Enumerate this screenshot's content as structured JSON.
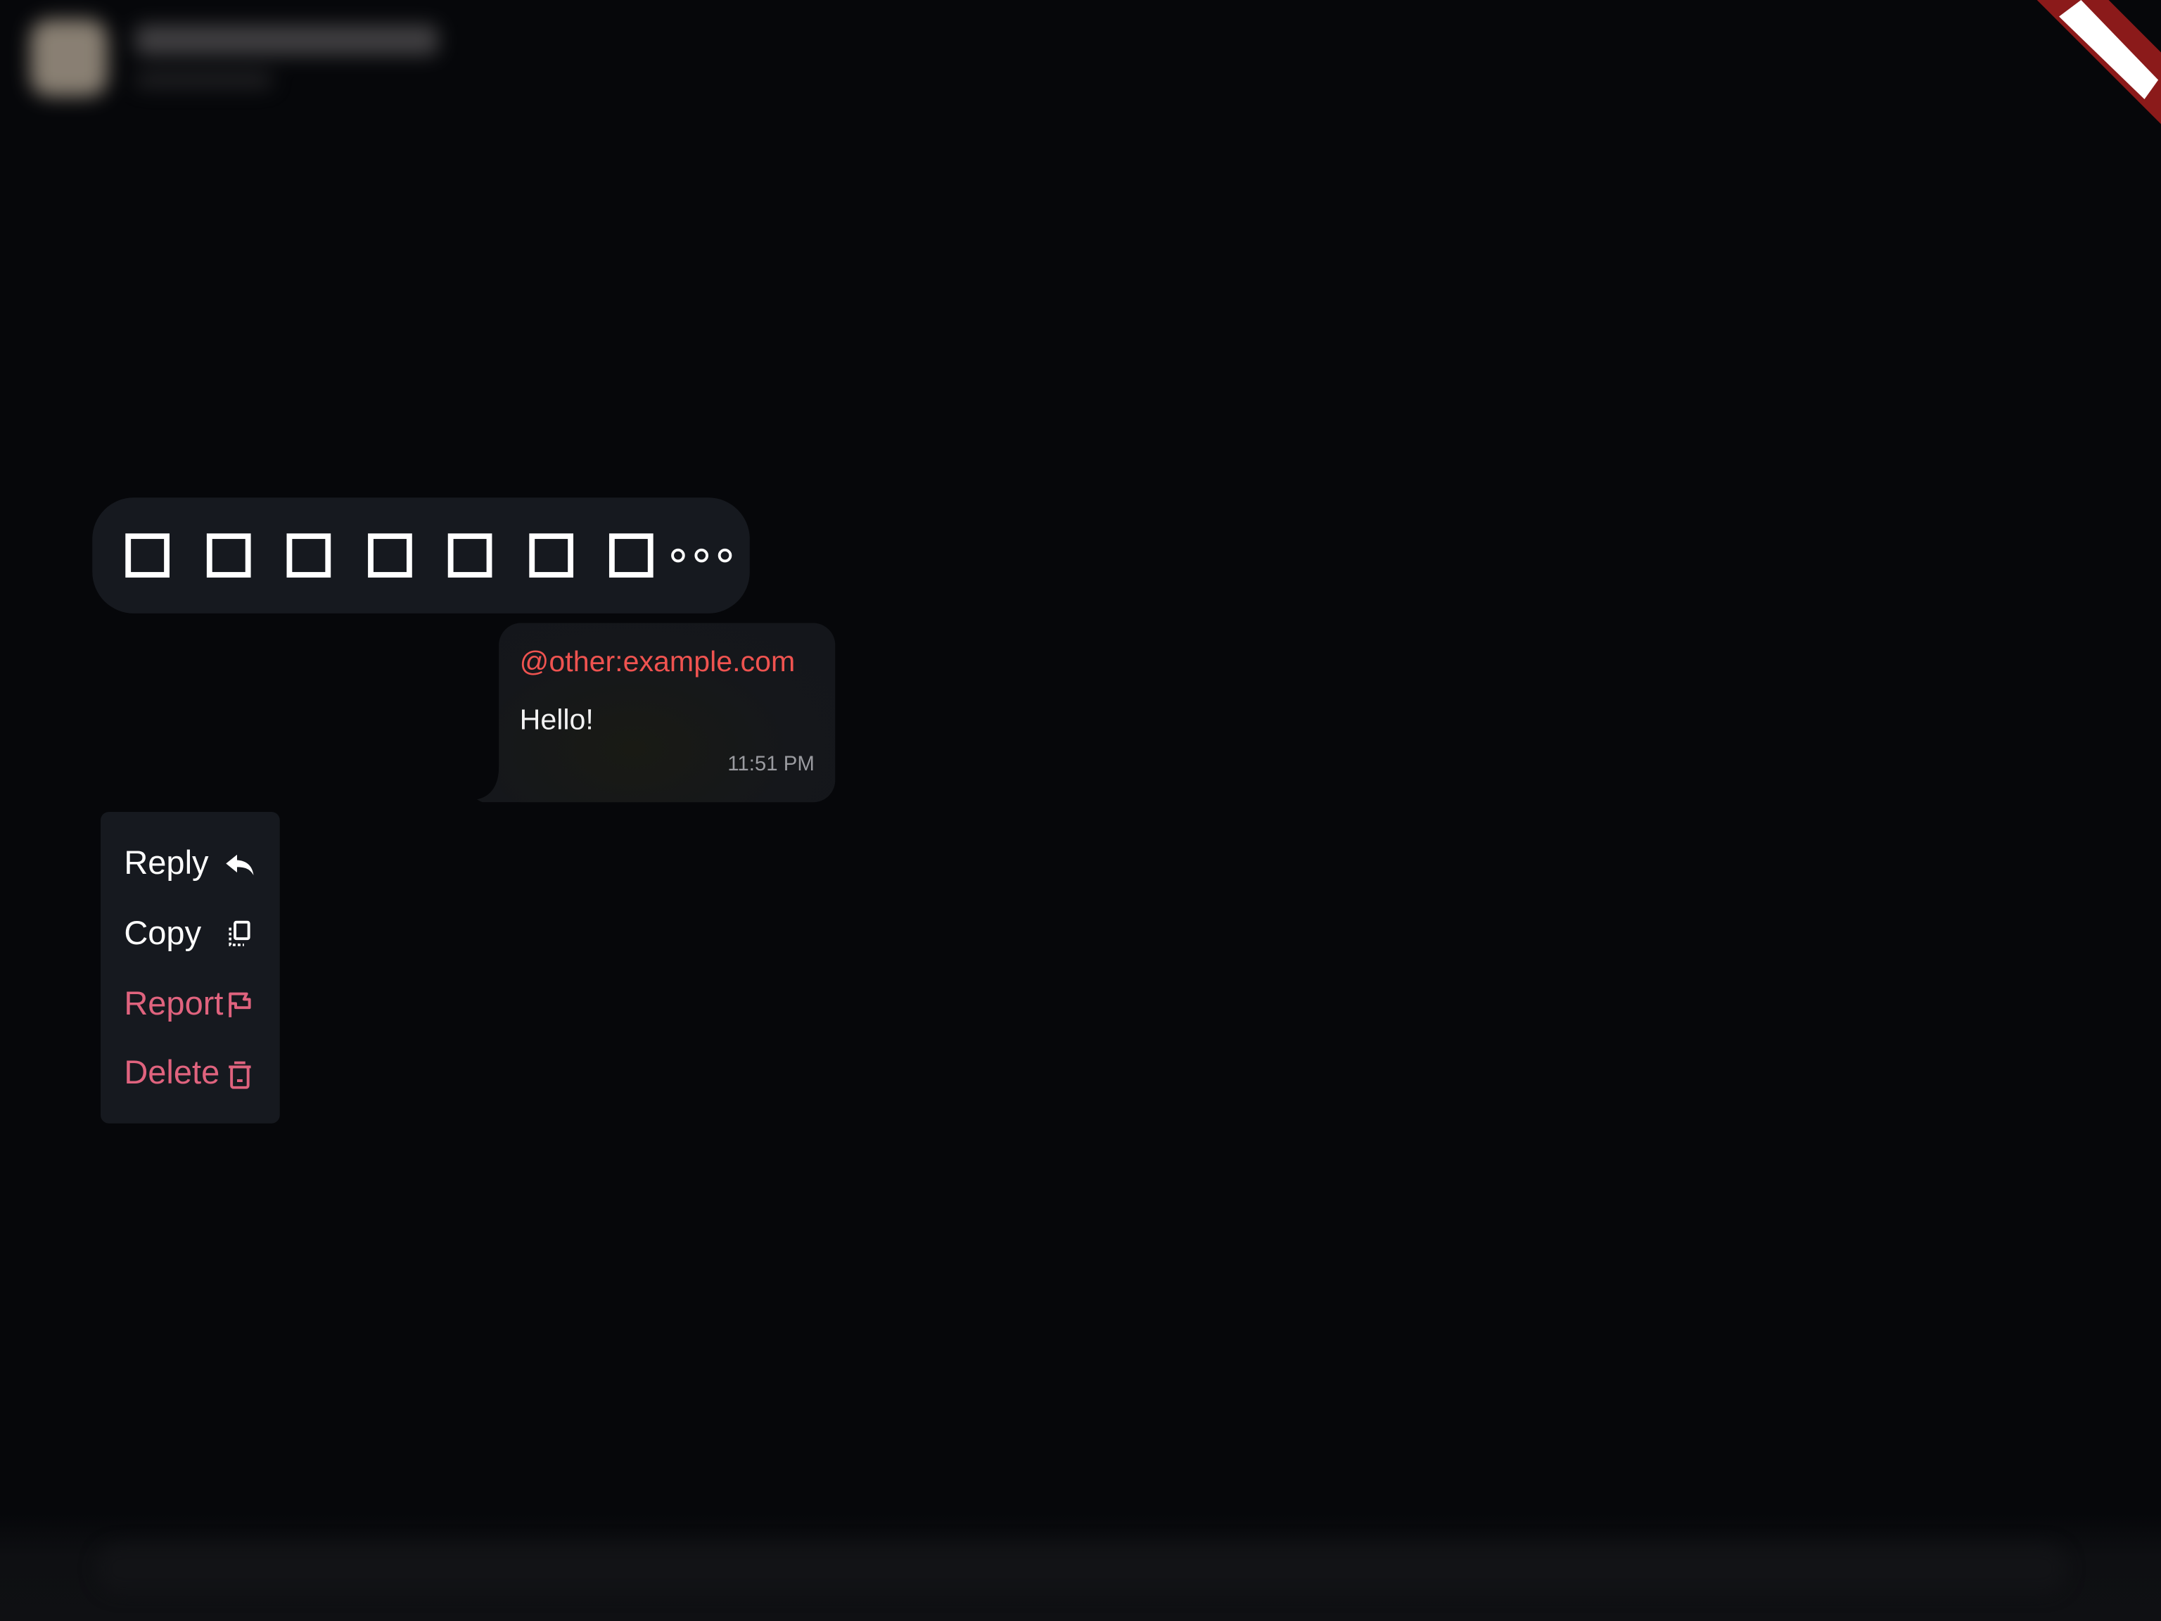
{
  "reaction_bar": {
    "reactions": [
      {
        "icon": "missing-glyph-icon"
      },
      {
        "icon": "missing-glyph-icon"
      },
      {
        "icon": "missing-glyph-icon"
      },
      {
        "icon": "missing-glyph-icon"
      },
      {
        "icon": "missing-glyph-icon"
      },
      {
        "icon": "missing-glyph-icon"
      },
      {
        "icon": "missing-glyph-icon"
      }
    ],
    "more_icon": "more-horizontal-icon"
  },
  "message": {
    "sender": "@other:example.com",
    "body": "Hello!",
    "time": "11:51 PM"
  },
  "context_menu": {
    "items": [
      {
        "label": "Reply",
        "icon": "reply-icon",
        "tone": "normal"
      },
      {
        "label": "Copy",
        "icon": "copy-icon",
        "tone": "normal"
      },
      {
        "label": "Report",
        "icon": "flag-icon",
        "tone": "danger"
      },
      {
        "label": "Delete",
        "icon": "trash-icon",
        "tone": "danger"
      }
    ]
  },
  "colors": {
    "background": "#06070a",
    "surface": "#16191f",
    "sender_name": "#ef5350",
    "danger": "#e0637e",
    "text": "#ffffff",
    "muted": "#9a9ba0",
    "debug_banner": "#8b1a1a"
  }
}
